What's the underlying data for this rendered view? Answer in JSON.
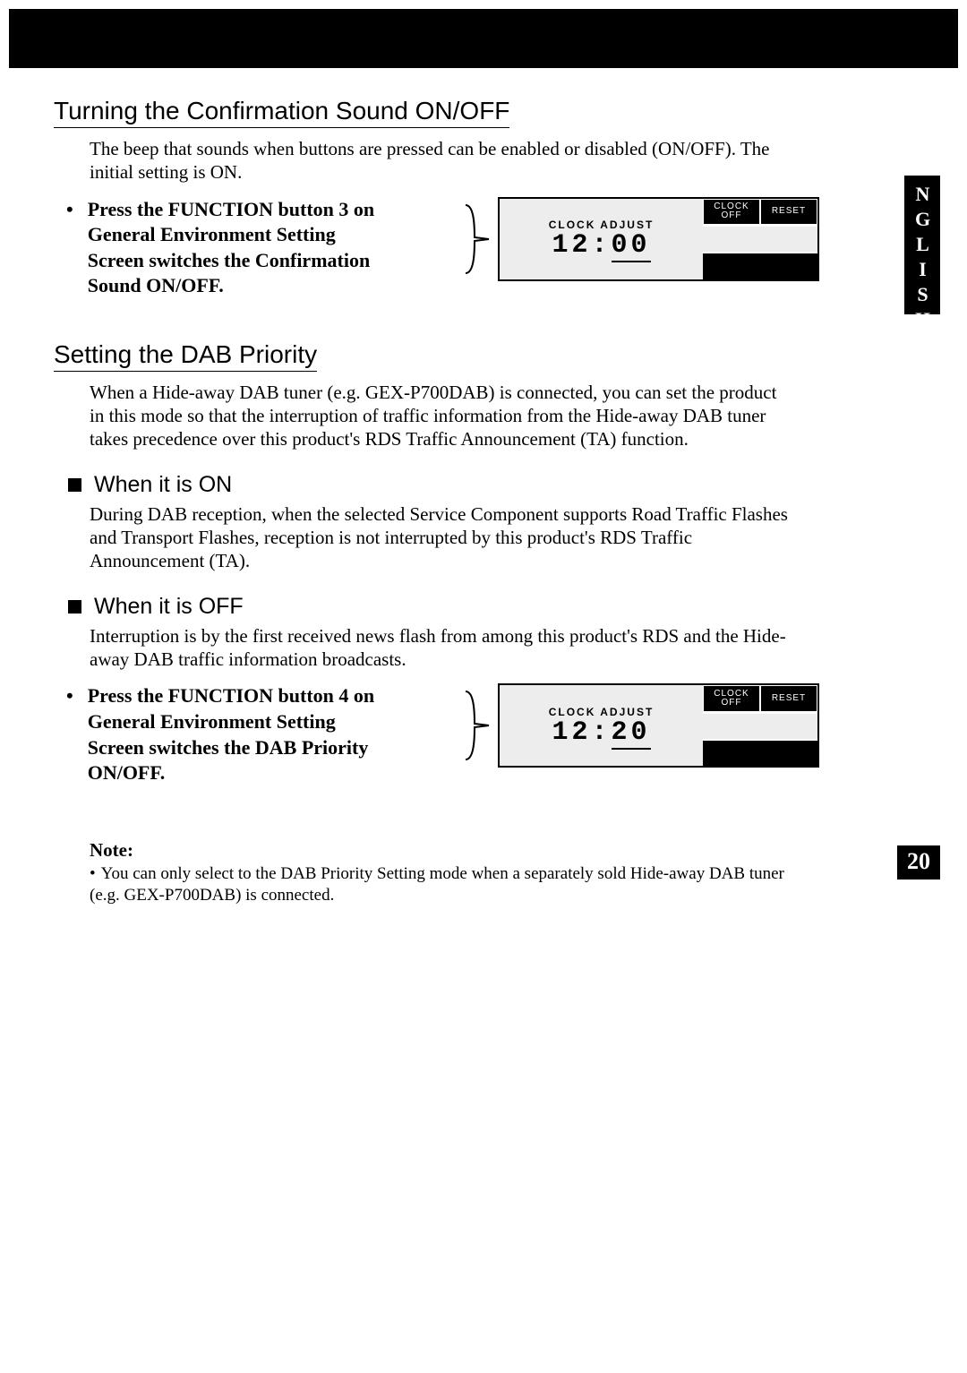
{
  "side_tab": "ENGLISH",
  "page_number": "20",
  "section1": {
    "title": "Turning the Confirmation Sound ON/OFF",
    "body": "The beep that sounds when buttons are pressed can be enabled or disabled (ON/OFF). The initial setting is ON.",
    "step": "Press the FUNCTION button 3 on General Environment Setting Screen switches the Confirmation Sound ON/OFF.",
    "panel": {
      "header": "CLOCK ADJUST",
      "time_left": "12:",
      "time_right": "00",
      "btn1a": "CLOCK",
      "btn1b": "OFF",
      "btn2": "RESET"
    }
  },
  "section2": {
    "title": "Setting the DAB Priority",
    "body": "When a Hide-away DAB tuner (e.g. GEX-P700DAB) is connected, you can set the product in this mode so that the interruption of traffic information from the Hide-away DAB tuner takes precedence over this product's RDS Traffic Announcement (TA) function.",
    "sub_on": {
      "title": "When it is ON",
      "body": "During DAB reception, when the selected Service Component supports Road Traffic Flashes and Transport Flashes, reception is not interrupted by this product's RDS Traffic Announcement (TA)."
    },
    "sub_off": {
      "title": "When it is OFF",
      "body": "Interruption is by the first received news flash from among this product's RDS and the Hide-away DAB traffic information broadcasts."
    },
    "step": "Press the FUNCTION button 4 on General Environment Setting Screen switches the DAB Priority ON/OFF.",
    "panel": {
      "header": "CLOCK ADJUST",
      "time_left": "12:",
      "time_right": "20",
      "btn1a": "CLOCK",
      "btn1b": "OFF",
      "btn2": "RESET"
    }
  },
  "note": {
    "label": "Note:",
    "item": "You can only select to the DAB Priority Setting mode when a separately sold Hide-away DAB tuner (e.g. GEX-P700DAB) is connected."
  }
}
